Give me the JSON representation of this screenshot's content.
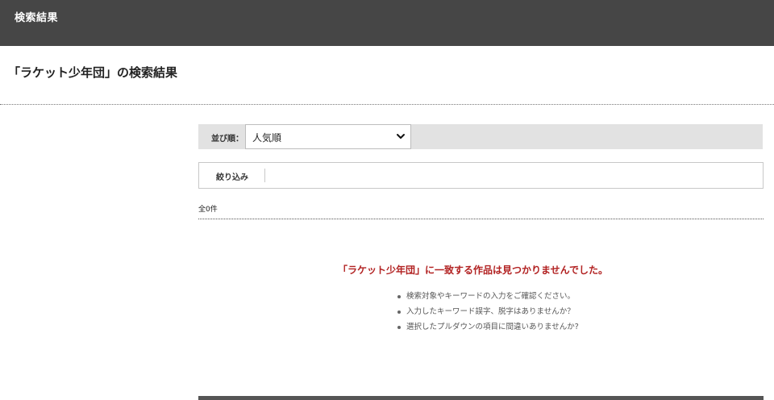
{
  "header": {
    "title": "検索結果"
  },
  "page": {
    "heading": "「ラケット少年団」の検索結果"
  },
  "sort": {
    "label": "並び順：",
    "selected": "人気順"
  },
  "filter": {
    "label": "絞り込み"
  },
  "results": {
    "count_text": "全0件",
    "no_result_message": "「ラケット少年団」に一致する作品は見つかりませんでした。",
    "hints": [
      "検索対象やキーワードの入力をご確認ください。",
      "入力したキーワード誤字、脱字はありませんか？",
      "選択したプルダウンの項目に間違いありませんか?"
    ]
  },
  "colors": {
    "header_bg": "#464646",
    "sort_bar_bg": "#e2e2e2",
    "error_text": "#b22222"
  }
}
